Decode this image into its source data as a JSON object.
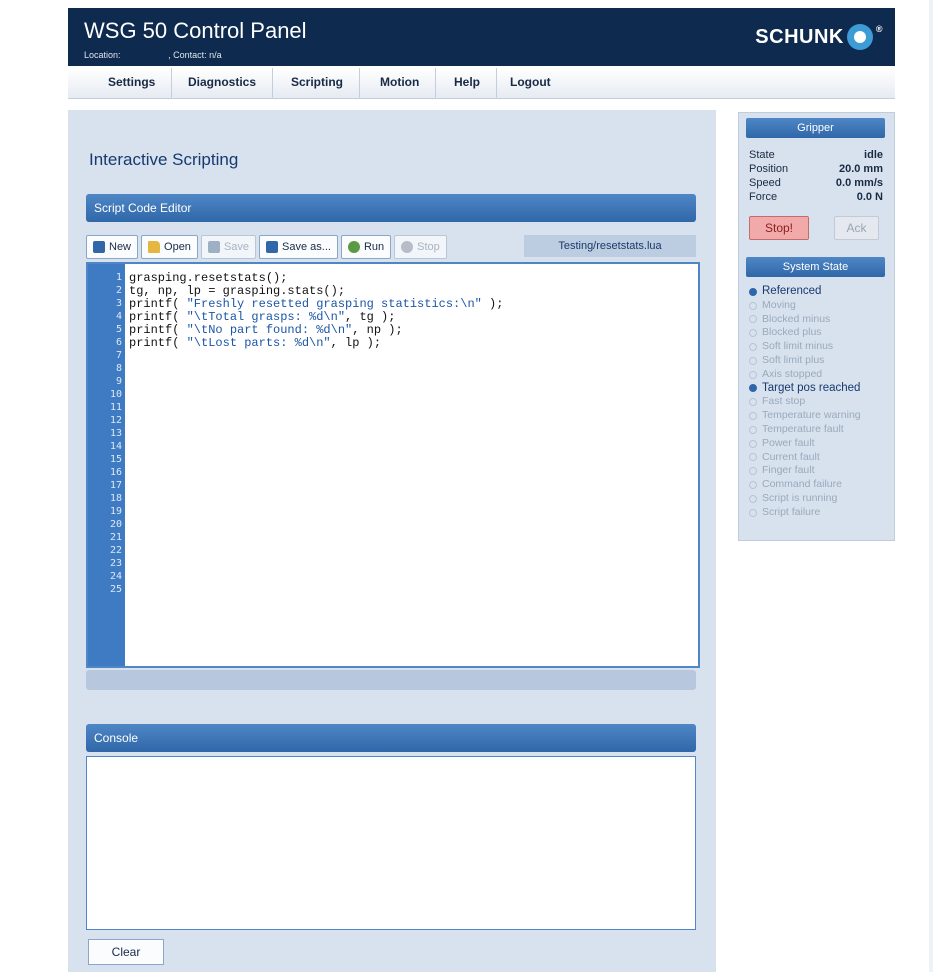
{
  "header": {
    "title": "WSG 50 Control Panel",
    "location_label": "Location:",
    "location_value": "                  ",
    "contact": ", Contact: n/a",
    "logo_text": "SCHUNK",
    "logo_reg": "®"
  },
  "nav": [
    {
      "label": "Settings"
    },
    {
      "label": "Diagnostics"
    },
    {
      "label": "Scripting"
    },
    {
      "label": "Motion"
    },
    {
      "label": "Help"
    },
    {
      "label": "Logout"
    }
  ],
  "main": {
    "page_title": "Interactive Scripting",
    "editor_header": "Script Code Editor",
    "toolbar": {
      "new": "New",
      "open": "Open",
      "save": "Save",
      "save_as": "Save as...",
      "run": "Run",
      "stop": "Stop"
    },
    "filename": "Testing/resetstats.lua",
    "line_numbers": [
      "1",
      "2",
      "3",
      "4",
      "5",
      "6",
      "7",
      "8",
      "9",
      "10",
      "11",
      "12",
      "13",
      "14",
      "15",
      "16",
      "17",
      "18",
      "19",
      "20",
      "21",
      "22",
      "23",
      "24",
      "25"
    ],
    "code": [
      {
        "plain": "grasping.resetstats();",
        "str": "",
        "tail": ""
      },
      {
        "plain": "tg, np, lp = grasping.stats();",
        "str": "",
        "tail": ""
      },
      {
        "plain": "printf( ",
        "str": "\"Freshly resetted grasping statistics:\\n\"",
        "tail": " );"
      },
      {
        "plain": "printf( ",
        "str": "\"\\tTotal grasps: %d\\n\"",
        "tail": ", tg );"
      },
      {
        "plain": "printf( ",
        "str": "\"\\tNo part found: %d\\n\"",
        "tail": ", np );"
      },
      {
        "plain": "printf( ",
        "str": "\"\\tLost parts: %d\\n\"",
        "tail": ", lp );"
      }
    ],
    "console_header": "Console",
    "clear": "Clear"
  },
  "gripper": {
    "header": "Gripper",
    "state_label": "State",
    "state_value": "idle",
    "position_label": "Position",
    "position_value": "20.0 mm",
    "speed_label": "Speed",
    "speed_value": "0.0 mm/s",
    "force_label": "Force",
    "force_value": "0.0 N",
    "stop": "Stop!",
    "ack": "Ack"
  },
  "system_state": {
    "header": "System State",
    "flags": [
      {
        "label": "Referenced",
        "active": true
      },
      {
        "label": "Moving",
        "active": false
      },
      {
        "label": "Blocked minus",
        "active": false
      },
      {
        "label": "Blocked plus",
        "active": false
      },
      {
        "label": "Soft limit minus",
        "active": false
      },
      {
        "label": "Soft limit plus",
        "active": false
      },
      {
        "label": "Axis stopped",
        "active": false
      },
      {
        "label": "Target pos reached",
        "active": true
      },
      {
        "label": "Fast stop",
        "active": false
      },
      {
        "label": "Temperature warning",
        "active": false
      },
      {
        "label": "Temperature fault",
        "active": false
      },
      {
        "label": "Power fault",
        "active": false
      },
      {
        "label": "Current fault",
        "active": false
      },
      {
        "label": "Finger fault",
        "active": false
      },
      {
        "label": "Command failure",
        "active": false
      },
      {
        "label": "Script is running",
        "active": false
      },
      {
        "label": "Script failure",
        "active": false
      }
    ]
  }
}
